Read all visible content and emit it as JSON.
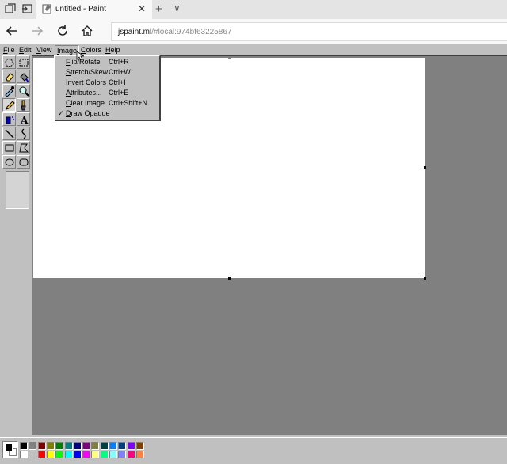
{
  "browser": {
    "tab_title": "untitled - Paint",
    "tab_close": "✕",
    "new_tab": "+",
    "tab_list": "∨",
    "address_host": "jspaint.ml",
    "address_path": "/#local:974bf63225867"
  },
  "menubar": {
    "items": [
      {
        "mnemonic": "F",
        "rest": "ile"
      },
      {
        "mnemonic": "E",
        "rest": "dit"
      },
      {
        "mnemonic": "V",
        "rest": "iew"
      },
      {
        "mnemonic": "I",
        "rest": "mage"
      },
      {
        "mnemonic": "C",
        "rest": "olors"
      },
      {
        "mnemonic": "H",
        "rest": "elp"
      }
    ]
  },
  "image_menu": {
    "items": [
      {
        "mnemonic": "F",
        "rest": "lip/Rotate",
        "shortcut": "Ctrl+R"
      },
      {
        "mnemonic": "S",
        "rest": "tretch/Skew",
        "shortcut": "Ctrl+W"
      },
      {
        "mnemonic": "I",
        "rest": "nvert Colors",
        "shortcut": "Ctrl+I"
      },
      {
        "mnemonic": "A",
        "rest": "ttributes...",
        "shortcut": "Ctrl+E"
      },
      {
        "mnemonic": "C",
        "rest": "lear Image",
        "shortcut": "Ctrl+Shift+N"
      },
      {
        "mnemonic": "D",
        "rest": "raw Opaque",
        "shortcut": "",
        "check": "✓"
      }
    ]
  },
  "tools": [
    "free-form-select-icon",
    "rect-select-icon",
    "eraser-icon",
    "fill-bucket-icon",
    "color-picker-icon",
    "magnifier-icon",
    "pencil-icon",
    "brush-icon",
    "airbrush-icon",
    "text-icon",
    "line-icon",
    "curve-icon",
    "rectangle-icon",
    "polygon-icon",
    "ellipse-icon",
    "rounded-rect-icon"
  ],
  "text_tool_glyph": "A",
  "palette": {
    "foreground": "#000000",
    "background": "#ffffff",
    "row1": [
      "#000000",
      "#808080",
      "#800000",
      "#808000",
      "#008000",
      "#008080",
      "#000080",
      "#800080",
      "#808040",
      "#004040",
      "#0080ff",
      "#004080",
      "#8000ff",
      "#804000"
    ],
    "row2": [
      "#ffffff",
      "#c0c0c0",
      "#ff0000",
      "#ffff00",
      "#00ff00",
      "#00ffff",
      "#0000ff",
      "#ff00ff",
      "#ffff80",
      "#00ff80",
      "#80ffff",
      "#8080ff",
      "#ff0080",
      "#ff8040"
    ]
  }
}
